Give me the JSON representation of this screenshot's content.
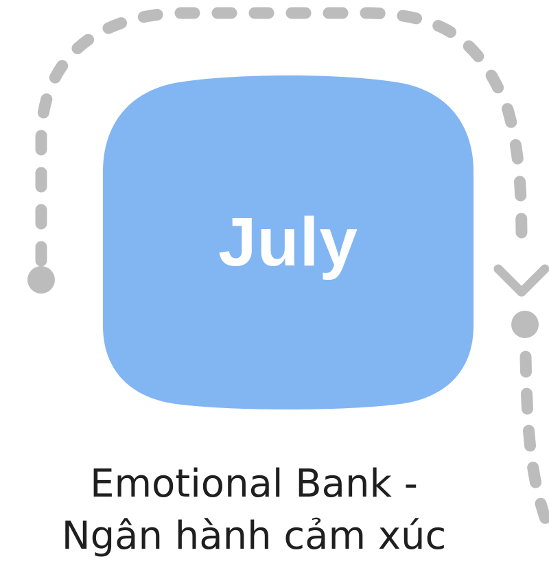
{
  "month": "July",
  "caption": {
    "line1": "Emotional Bank -",
    "line2": "Ngân hành cảm xúc"
  },
  "colors": {
    "card": "#82b6f2",
    "path": "#bcbcbc",
    "text": "#1f1f1f"
  }
}
